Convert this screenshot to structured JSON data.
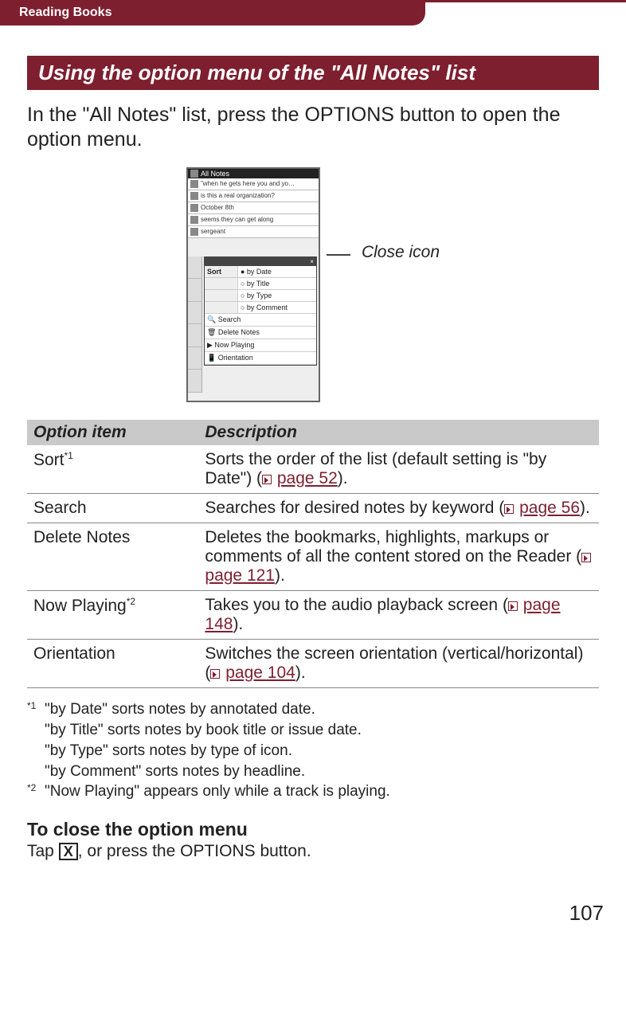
{
  "header": {
    "breadcrumb": "Reading Books"
  },
  "title": "Using the option menu of the \"All Notes\" list",
  "intro": "In the \"All Notes\" list, press the OPTIONS button to open the option menu.",
  "screenshot": {
    "title": "All Notes",
    "rows": [
      {
        "text": "\"when he gets here you and yo…",
        "sub": ""
      },
      {
        "text": "is this a real organization?",
        "sub": ""
      },
      {
        "text": "October 8th",
        "sub": ""
      },
      {
        "text": "seems they can get along",
        "sub": ""
      },
      {
        "text": "sergeant",
        "sub": ""
      }
    ],
    "menu": {
      "sort_label": "Sort",
      "options": [
        "by Date",
        "by Title",
        "by Type",
        "by Comment"
      ],
      "items": [
        "Search",
        "Delete Notes",
        "Now Playing",
        "Orientation"
      ]
    },
    "close_label": "Close icon"
  },
  "table": {
    "head": {
      "c1": "Option item",
      "c2": "Description"
    },
    "rows": [
      {
        "item": "Sort",
        "sup": "*1",
        "desc_pre": "Sorts the order of the list (default setting is \"by Date\") (",
        "link": "page 52",
        "desc_post": ")."
      },
      {
        "item": "Search",
        "sup": "",
        "desc_pre": "Searches for desired notes by keyword (",
        "link": "page 56",
        "desc_post": ")."
      },
      {
        "item": "Delete Notes",
        "sup": "",
        "desc_pre": "Deletes the bookmarks, highlights, markups or comments of all the content stored on the Reader (",
        "link": "page 121",
        "desc_post": ")."
      },
      {
        "item": "Now Playing",
        "sup": "*2",
        "desc_pre": "Takes you to the audio playback screen (",
        "link": "page 148",
        "desc_post": ")."
      },
      {
        "item": "Orientation",
        "sup": "",
        "desc_pre": "Switches the screen orientation (vertical/horizontal) (",
        "link": "page 104",
        "desc_post": ")."
      }
    ]
  },
  "footnotes": {
    "f1_mark": "*1",
    "f1_lines": [
      "\"by Date\" sorts notes by annotated date.",
      "\"by Title\" sorts notes by book title or issue date.",
      "\"by Type\" sorts notes by type of icon.",
      "\"by Comment\" sorts notes by headline."
    ],
    "f2_mark": "*2",
    "f2": "\"Now Playing\" appears only while a track is playing."
  },
  "close_section": {
    "heading": "To close the option menu",
    "text_pre": "Tap ",
    "x": "X",
    "text_post": ", or press the OPTIONS button."
  },
  "page_number": "107"
}
